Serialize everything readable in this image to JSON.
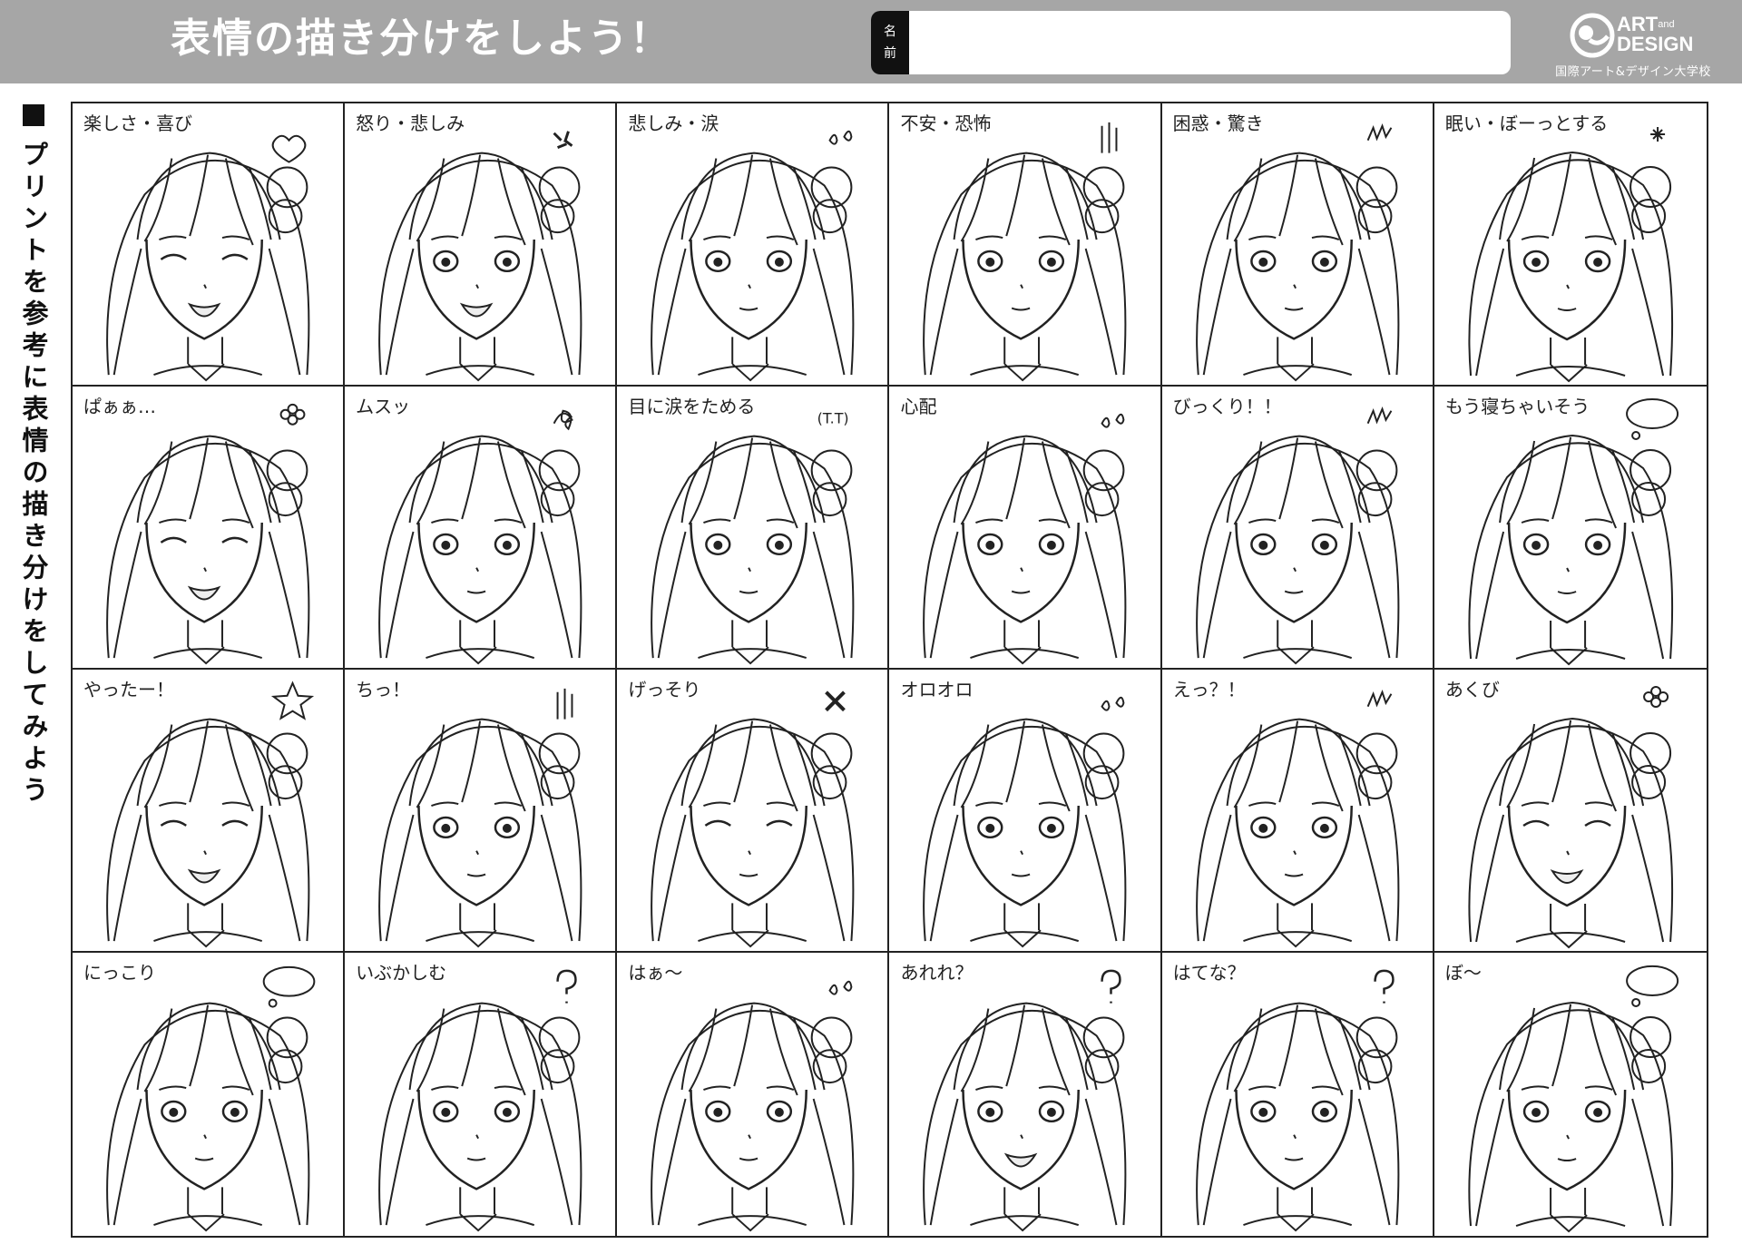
{
  "header": {
    "title": "表情の描き分けをしよう！",
    "name_label_chars": [
      "名",
      "前"
    ],
    "name_value": "",
    "logo_line1": "ART",
    "logo_and": "and",
    "logo_line2": "DESIGN",
    "logo_sub": "国際アート&デザイン大学校"
  },
  "side": {
    "text": "プリントを参考に表情の描き分けをしてみよう"
  },
  "cells": [
    {
      "label": "楽しさ・喜び",
      "icon": "heart"
    },
    {
      "label": "怒り・悲しみ",
      "icon": "anger"
    },
    {
      "label": "悲しみ・涙",
      "icon": "sweat"
    },
    {
      "label": "不安・恐怖",
      "icon": "lines"
    },
    {
      "label": "困惑・驚き",
      "icon": "spike"
    },
    {
      "label": "眠い・ぼーっとする",
      "icon": "sparkle"
    },
    {
      "label": "ぱぁぁ…",
      "icon": "flower"
    },
    {
      "label": "ムスッ",
      "icon": "scribble"
    },
    {
      "label": "目に涙をためる",
      "icon": "tt"
    },
    {
      "label": "心配",
      "icon": "sweat"
    },
    {
      "label": "びっくり！！",
      "icon": "spike"
    },
    {
      "label": "もう寝ちゃいそう",
      "icon": "bubble"
    },
    {
      "label": "やったー！",
      "icon": "star"
    },
    {
      "label": "ちっ！",
      "icon": "lines"
    },
    {
      "label": "げっそり",
      "icon": "cross"
    },
    {
      "label": "オロオロ",
      "icon": "sweat"
    },
    {
      "label": "えっ？！",
      "icon": "spike"
    },
    {
      "label": "あくび",
      "icon": "flower"
    },
    {
      "label": "にっこり",
      "icon": "bubble"
    },
    {
      "label": "いぶかしむ",
      "icon": "question"
    },
    {
      "label": "はぁ～",
      "icon": "sweat"
    },
    {
      "label": "あれれ？",
      "icon": "question"
    },
    {
      "label": "はてな？",
      "icon": "question"
    },
    {
      "label": "ぼ～",
      "icon": "bubble"
    }
  ],
  "colors": {
    "header_bg": "#a6a6a6",
    "line": "#222222"
  }
}
